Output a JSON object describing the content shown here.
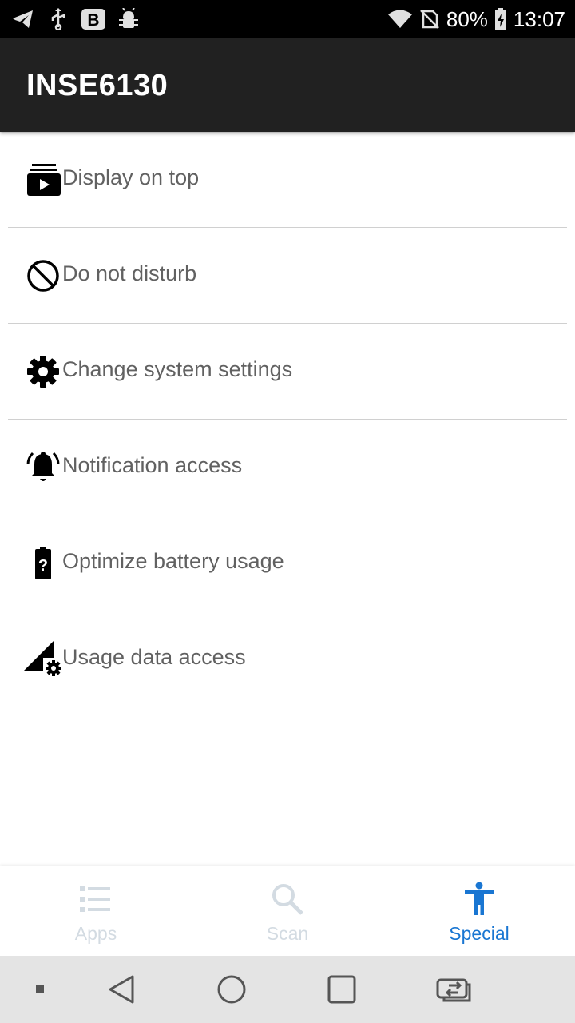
{
  "status_bar": {
    "battery": "80%",
    "time": "13:07",
    "left_icons": [
      "telegram-icon",
      "usb-icon",
      "b-app-icon",
      "android-debug-icon"
    ],
    "right_icons": [
      "wifi-icon",
      "no-sim-icon",
      "battery-charging-icon"
    ]
  },
  "app_bar": {
    "title": "INSE6130"
  },
  "list": {
    "items": [
      {
        "label": "Display on top",
        "icon": "display-on-top-icon"
      },
      {
        "label": "Do not disturb",
        "icon": "do-not-disturb-icon"
      },
      {
        "label": "Change system settings",
        "icon": "gear-icon"
      },
      {
        "label": "Notification access",
        "icon": "notification-bell-icon"
      },
      {
        "label": "Optimize battery usage",
        "icon": "battery-unknown-icon"
      },
      {
        "label": "Usage data access",
        "icon": "signal-settings-icon"
      }
    ]
  },
  "bottom_nav": {
    "items": [
      {
        "label": "Apps",
        "icon": "list-icon",
        "active": false
      },
      {
        "label": "Scan",
        "icon": "search-icon",
        "active": false
      },
      {
        "label": "Special",
        "icon": "accessibility-icon",
        "active": true
      }
    ]
  },
  "system_nav": {
    "buttons": [
      "notification-dot",
      "back-icon",
      "home-icon",
      "recents-icon",
      "switch-apps-icon"
    ]
  },
  "colors": {
    "status_bar": "#000000",
    "app_bar": "#212121",
    "accent": "#1976d2",
    "inactive_nav": "#d3dbe2",
    "list_text": "#616161",
    "system_nav": "#e4e4e4"
  }
}
